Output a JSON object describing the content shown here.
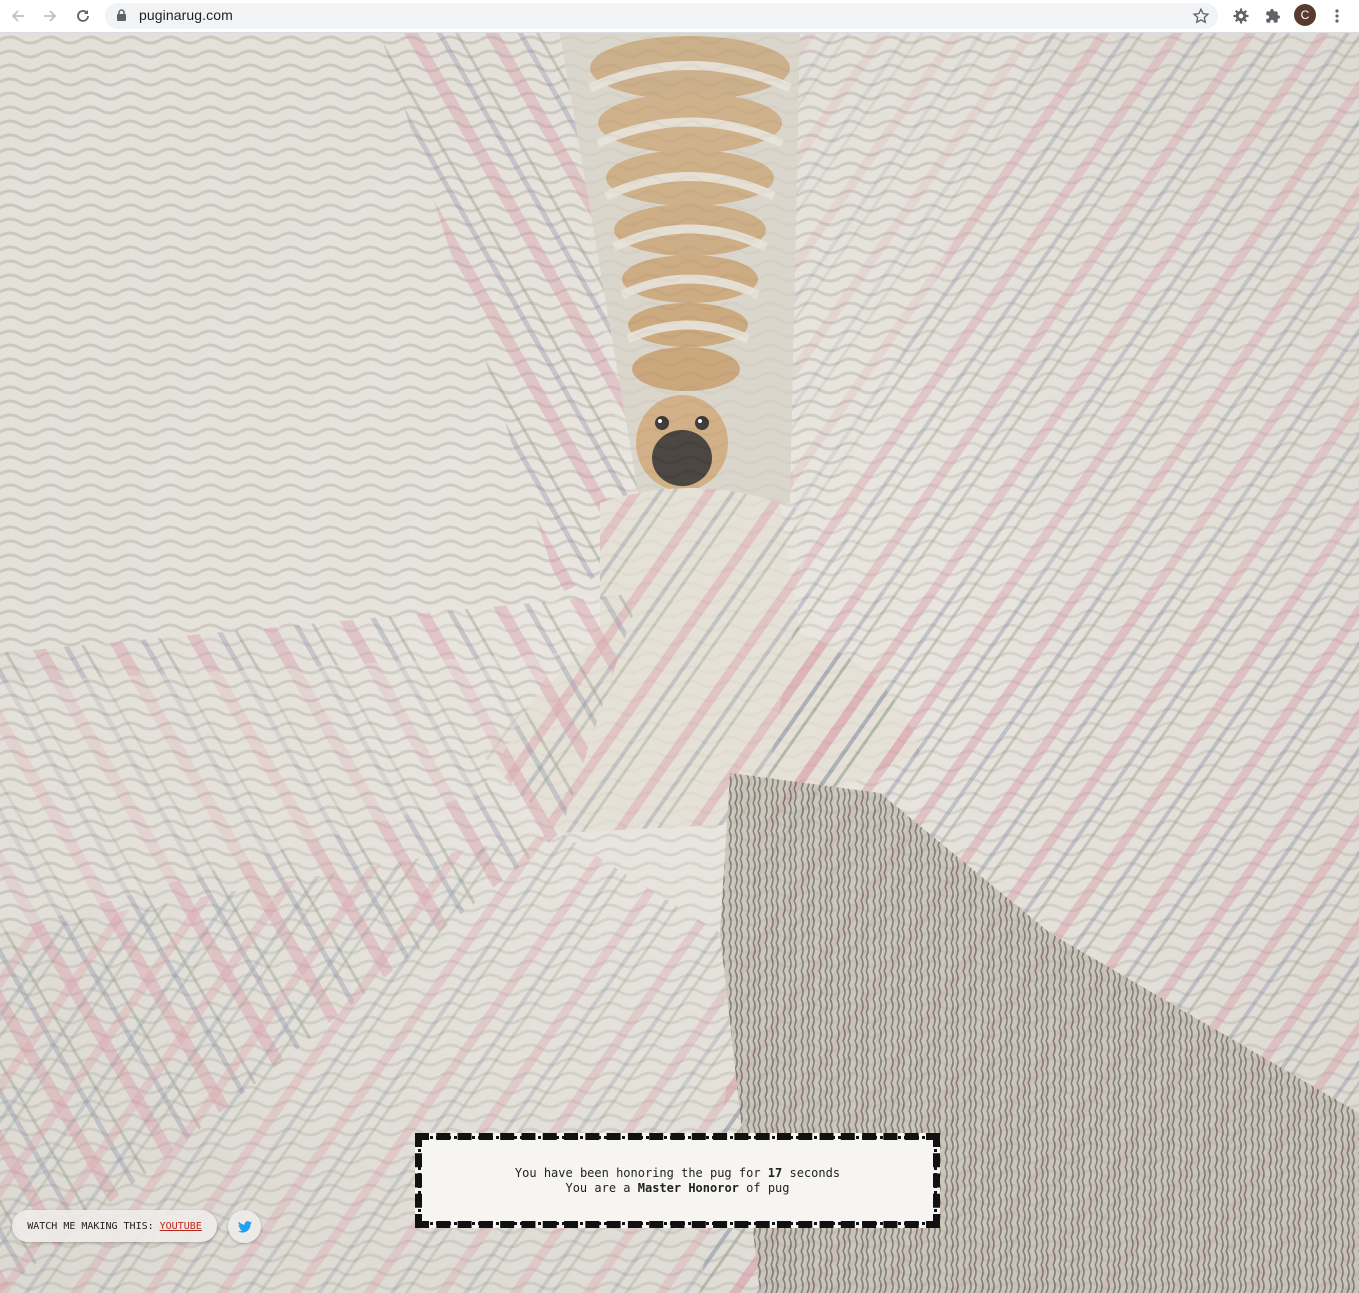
{
  "browser": {
    "url": "puginarug.com",
    "profile_initial": "C"
  },
  "icons": {
    "back": "arrow-left-icon",
    "forward": "arrow-right-icon",
    "reload": "reload-icon",
    "lock": "lock-icon",
    "bookmark": "star-icon",
    "extension_one": "gear-icon",
    "extensions": "puzzle-icon",
    "menu": "kebab-menu-icon",
    "twitter": "twitter-bird-icon"
  },
  "honor": {
    "prefix": "You have been honoring the pug for",
    "seconds": "17",
    "suffix": "seconds",
    "rank_prefix": "You are a",
    "rank": "Master Honoror",
    "rank_suffix": "of pug"
  },
  "footer": {
    "watch_label": "WATCH ME MAKING THIS:",
    "youtube_link": "YOUTUBE"
  },
  "colors": {
    "rug_base": "#e3e0da",
    "rug_pink": "#d79aa7",
    "rug_blue": "#7f8aa0",
    "rug_green": "#8a9a86",
    "link_red": "#c0271b",
    "twitter_blue": "#1da1f2"
  }
}
